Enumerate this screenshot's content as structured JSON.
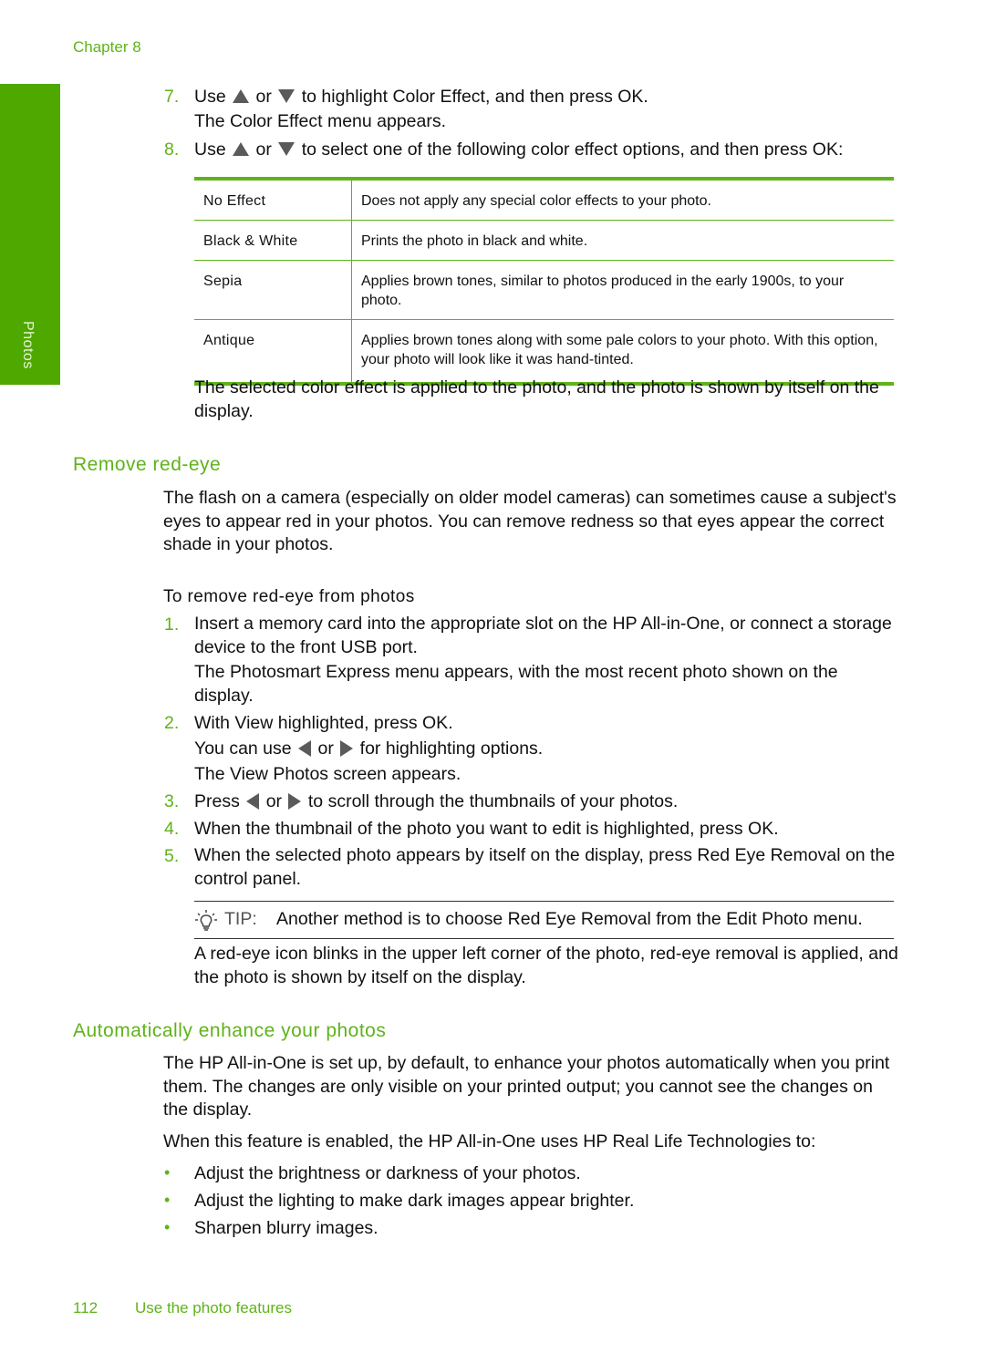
{
  "header": {
    "chapter": "Chapter 8"
  },
  "side_tab": {
    "label": "Photos",
    "color": "#4ea800"
  },
  "steps_top": [
    {
      "num": "7.",
      "pre": "Use",
      "mid": "or",
      "post": "to highlight Color Effect, and then press OK.",
      "note": "The Color Effect menu appears."
    },
    {
      "num": "8.",
      "pre": "Use",
      "mid": "or",
      "post": "to select one of the following color effect options, and then press OK:"
    }
  ],
  "effects_table": {
    "rows": [
      {
        "name": "No Effect",
        "description": "Does not apply any special color effects to your photo."
      },
      {
        "name": "Black & White",
        "description": "Prints the photo in black and white."
      },
      {
        "name": "Sepia",
        "description": "Applies brown tones, similar to photos produced in the early 1900s, to your photo."
      },
      {
        "name": "Antique",
        "description": "Applies brown tones along with some pale colors to your photo. With this option, your photo will look like it was hand-tinted."
      }
    ]
  },
  "after_table": "The selected color effect is applied to the photo, and the photo is shown by itself on the display.",
  "red_eye": {
    "heading": "Remove red-eye",
    "intro": "The flash on a camera (especially on older model cameras) can sometimes cause a subject's eyes to appear red in your photos. You can remove redness so that eyes appear the correct shade in your photos.",
    "procedure_title": "To remove red-eye from photos",
    "steps": [
      {
        "num": "1.",
        "text": "Insert a memory card into the appropriate slot on the HP All-in-One, or connect a storage device to the front USB port.",
        "note": "The Photosmart Express menu appears, with the most recent photo shown on the display."
      },
      {
        "num": "2.",
        "text": "With View highlighted, press OK.",
        "note_pre": "You can use",
        "note_mid": "or",
        "note_post": "for highlighting options.",
        "note2": "The View Photos screen appears."
      },
      {
        "num": "3.",
        "pre": "Press",
        "mid": "or",
        "post": "to scroll through the thumbnails of your photos."
      },
      {
        "num": "4.",
        "text": "When the thumbnail of the photo you want to edit is highlighted, press OK."
      },
      {
        "num": "5.",
        "text": "When the selected photo appears by itself on the display, press Red Eye Removal on the control panel."
      }
    ],
    "tip_label": "TIP:",
    "tip_text": "Another method is to choose Red Eye Removal from the Edit Photo menu.",
    "result": "A red-eye icon blinks in the upper left corner of the photo, red-eye removal is applied, and the photo is shown by itself on the display."
  },
  "enhance": {
    "heading": "Automatically enhance your photos",
    "intro": "The HP All-in-One is set up, by default, to enhance your photos automatically when you print them. The changes are only visible on your printed output; you cannot see the changes on the display.",
    "lead": "When this feature is enabled, the HP All-in-One uses HP Real Life Technologies to:",
    "bullets": [
      "Adjust the brightness or darkness of your photos.",
      "Adjust the lighting to make dark images appear brighter.",
      "Sharpen blurry images."
    ]
  },
  "footer": {
    "page_number": "112",
    "section": "Use the photo features"
  },
  "colors": {
    "accent": "#5fb31a",
    "text": "#111111",
    "arrow": "#5a5a5a"
  }
}
